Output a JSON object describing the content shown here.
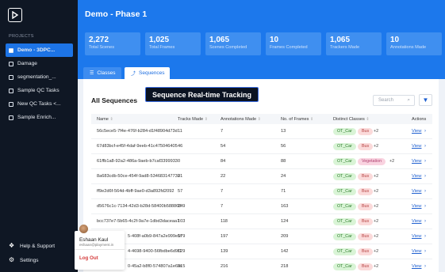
{
  "sidebar": {
    "section_label": "PROJECTS",
    "items": [
      {
        "label": "Demo - 3DPC..."
      },
      {
        "label": "Damage"
      },
      {
        "label": "segmentation_..."
      },
      {
        "label": "Sample QC Tasks"
      },
      {
        "label": "New QC Tasks <..."
      },
      {
        "label": "Sample Enrich..."
      }
    ],
    "help_label": "Help & Support",
    "settings_label": "Settings"
  },
  "user_menu": {
    "name": "Eshaan Kaul",
    "email": "eshaan@playment.in",
    "logout": "Log Out"
  },
  "header": {
    "title": "Demo - Phase 1",
    "stats": [
      {
        "value": "2,272",
        "label": "Total Scenes"
      },
      {
        "value": "1,025",
        "label": "Total Frames"
      },
      {
        "value": "1,065",
        "label": "Scenes Completed"
      },
      {
        "value": "10",
        "label": "Frames Completed"
      },
      {
        "value": "1,065",
        "label": "Trackers Made"
      },
      {
        "value": "10",
        "label": "Annotations Made"
      }
    ]
  },
  "tabs": [
    {
      "label": "Classes",
      "icon": "list-icon"
    },
    {
      "label": "Sequences",
      "icon": "sequence-icon"
    }
  ],
  "table": {
    "title": "All Sequences",
    "tooltip": "Sequence Real-time Tracking",
    "search_placeholder": "Search",
    "headers": [
      "Name",
      "Tracks Made",
      "Annotations Made",
      "No. of Frames",
      "Distinct Classes",
      "Actions"
    ],
    "rows": [
      {
        "name": "56c5ece5-7f4e-476f-b284-d1f48904d73d",
        "tracks": "11",
        "annotations": "7",
        "frames": "13",
        "tags": [
          "OT_Car",
          "Bus"
        ],
        "more": "+2",
        "action": "View"
      },
      {
        "name": "67d83bcf-e45f-4daf-9eeb-41c475046405",
        "tracks": "46",
        "annotations": "54",
        "frames": "56",
        "tags": [
          "OT_Car",
          "Bus"
        ],
        "more": "+2",
        "action": "View"
      },
      {
        "name": "61ffb1a8-92a2-486a-9aeb-b7caf3399933",
        "tracks": "0",
        "annotations": "84",
        "frames": "88",
        "tags": [
          "OT_Car",
          "Vegetation"
        ],
        "more": "+2",
        "action": "View"
      },
      {
        "name": "8a683cdb-50ce-454f-9ad8-534683147730",
        "tracks": "21",
        "annotations": "22",
        "frames": "24",
        "tags": [
          "OT_Car",
          "Bus"
        ],
        "more": "+2",
        "action": "View"
      },
      {
        "name": "ff9e2d6f-564d-4bff-9ae0-d3a892fd2092",
        "tracks": "57",
        "annotations": "7",
        "frames": "71",
        "tags": [
          "OT_Car",
          "Bus"
        ],
        "more": "+2",
        "action": "View"
      },
      {
        "name": "d5676c1c-7134-42d3-b28d-58400b588868",
        "tracks": "149",
        "annotations": "7",
        "frames": "163",
        "tags": [
          "OT_Car",
          "Bus"
        ],
        "more": "+2",
        "action": "View"
      },
      {
        "name": "bcc737e7-5b65-4c2f-9a7e-1dbd3daceaa7",
        "tracks": "103",
        "annotations": "118",
        "frames": "124",
        "tags": [
          "OT_Car",
          "Bus"
        ],
        "more": "+2",
        "action": "View"
      },
      {
        "name": "5-408f-a0b9-847a2e999e5f",
        "tracks": "179",
        "annotations": "197",
        "frames": "209",
        "tags": [
          "OT_Car",
          "Bus"
        ],
        "more": "+2",
        "action": "View"
      },
      {
        "name": "4-4698-9400-56fbdbe6d9f1",
        "tracks": "129",
        "annotations": "139",
        "frames": "142",
        "tags": [
          "OT_Car",
          "Bus"
        ],
        "more": "+2",
        "action": "View"
      },
      {
        "name": "0-45a2-b8f0-574807a1e6fe",
        "tracks": "215",
        "annotations": "216",
        "frames": "218",
        "tags": [
          "OT_Car",
          "Bus"
        ],
        "more": "+2",
        "action": "View"
      }
    ]
  }
}
